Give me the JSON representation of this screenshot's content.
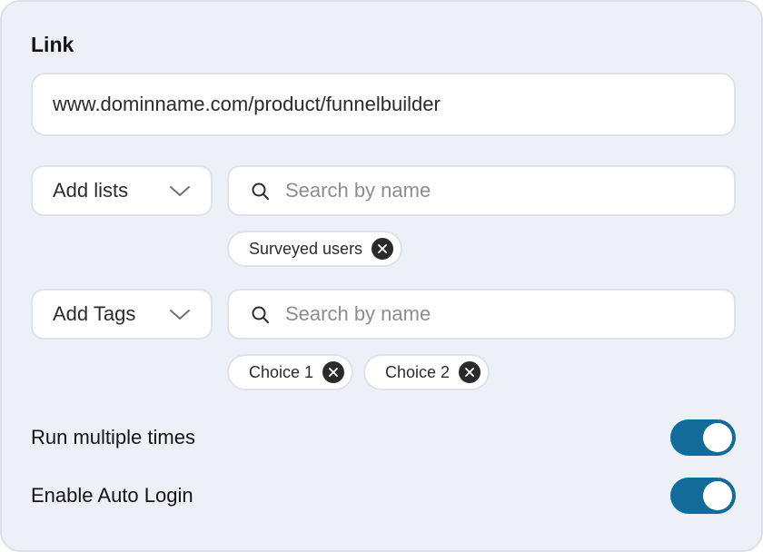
{
  "section": {
    "title": "Link"
  },
  "link": {
    "value": "www.dominname.com/product/funnelbuilder"
  },
  "lists": {
    "dropdown_label": "Add lists",
    "search_placeholder": "Search by name",
    "chips": [
      "Surveyed users"
    ]
  },
  "tags": {
    "dropdown_label": "Add Tags",
    "search_placeholder": "Search by name",
    "chips": [
      "Choice 1",
      "Choice 2"
    ]
  },
  "settings": {
    "run_multiple": {
      "label": "Run multiple times",
      "on": true
    },
    "auto_login": {
      "label": "Enable Auto Login",
      "on": true
    }
  },
  "colors": {
    "toggle_on": "#126c9a",
    "panel_bg": "#eef0f7",
    "chip_remove": "#2a2a2c"
  },
  "icons": {
    "dropdown": "chevron-down-icon",
    "search": "search-icon",
    "remove": "close-icon"
  }
}
